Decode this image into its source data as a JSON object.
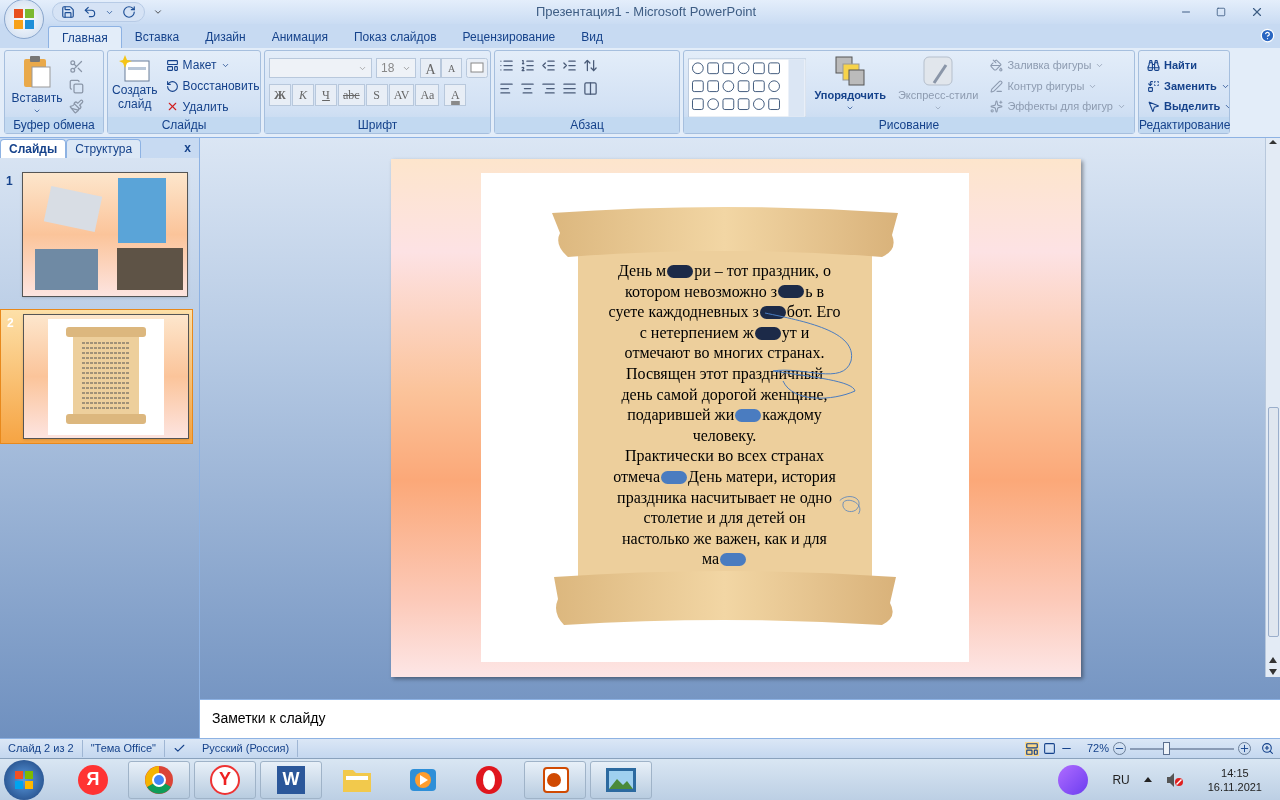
{
  "window": {
    "title": "Презентация1 - Microsoft PowerPoint"
  },
  "ribbon": {
    "tabs": [
      {
        "label": "Главная",
        "selected": true
      },
      {
        "label": "Вставка",
        "selected": false
      },
      {
        "label": "Дизайн",
        "selected": false
      },
      {
        "label": "Анимация",
        "selected": false
      },
      {
        "label": "Показ слайдов",
        "selected": false
      },
      {
        "label": "Рецензирование",
        "selected": false
      },
      {
        "label": "Вид",
        "selected": false
      }
    ],
    "clipboard": {
      "label": "Буфер обмена",
      "paste": "Вставить"
    },
    "slides": {
      "label": "Слайды",
      "new_slide": "Создать слайд",
      "layout": "Макет",
      "reset": "Восстановить",
      "delete": "Удалить"
    },
    "font": {
      "label": "Шрифт",
      "size": "18",
      "size_buttons": [
        "A",
        "A"
      ],
      "buttons": [
        "Ж",
        "К",
        "Ч",
        "abc",
        "S",
        "AV",
        "Aa",
        "A"
      ]
    },
    "paragraph": {
      "label": "Абзац"
    },
    "drawing": {
      "label": "Рисование",
      "arrange": "Упорядочить",
      "quick_styles": {
        "label": "Экспресс-стили",
        "disabled": true
      },
      "commands": [
        {
          "label": "Заливка фигуры",
          "disabled": true
        },
        {
          "label": "Контур фигуры",
          "disabled": true
        },
        {
          "label": "Эффекты для фигур",
          "disabled": true
        }
      ]
    },
    "editing": {
      "label": "Редактирование",
      "commands": [
        {
          "label": "Найти"
        },
        {
          "label": "Заменить"
        },
        {
          "label": "Выделить"
        }
      ]
    }
  },
  "slide_panel": {
    "tabs": [
      {
        "label": "Слайды",
        "selected": true
      },
      {
        "label": "Структура",
        "selected": false
      }
    ],
    "close": "x",
    "thumbnails": [
      {
        "number": "1",
        "selected": false
      },
      {
        "number": "2",
        "selected": true
      }
    ]
  },
  "slide": {
    "lines": [
      {
        "segments": [
          {
            "kind": "text",
            "text": "День м"
          },
          {
            "kind": "blot",
            "color": "#1c2a48"
          },
          {
            "kind": "text",
            "text": "ри – тот праздник, о"
          }
        ]
      },
      {
        "segments": [
          {
            "kind": "text",
            "text": "котором невозможно з"
          },
          {
            "kind": "blot",
            "color": "#1c2a48"
          },
          {
            "kind": "text",
            "text": "ь в"
          }
        ]
      },
      {
        "segments": [
          {
            "kind": "text",
            "text": "суете каждодневных з"
          },
          {
            "kind": "blot",
            "color": "#1c2a48"
          },
          {
            "kind": "text",
            "text": "бот. Его"
          }
        ]
      },
      {
        "segments": [
          {
            "kind": "text",
            "text": "с нетерпением ж"
          },
          {
            "kind": "blot",
            "color": "#1c2a48"
          },
          {
            "kind": "text",
            "text": "ут и"
          }
        ]
      },
      {
        "segments": [
          {
            "kind": "text",
            "text": "отмечают во многих странах."
          }
        ]
      },
      {
        "segments": [
          {
            "kind": "text",
            "text": "Посвящен этот праздничный"
          }
        ]
      },
      {
        "segments": [
          {
            "kind": "text",
            "text": "день самой дорогой женщине,"
          }
        ]
      },
      {
        "segments": [
          {
            "kind": "text",
            "text": "подарившей жи"
          },
          {
            "kind": "blot",
            "color": "#4a7cc0"
          },
          {
            "kind": "text",
            "text": "каждому"
          }
        ]
      },
      {
        "segments": [
          {
            "kind": "text",
            "text": "человеку."
          }
        ]
      },
      {
        "segments": [
          {
            "kind": "text",
            "text": "Практически во всех странах"
          }
        ]
      },
      {
        "segments": [
          {
            "kind": "text",
            "text": "отмеча"
          },
          {
            "kind": "blot",
            "color": "#4a7cc0"
          },
          {
            "kind": "text",
            "text": "День матери, история"
          }
        ]
      },
      {
        "segments": [
          {
            "kind": "text",
            "text": "праздника насчитывает не одно"
          }
        ]
      },
      {
        "segments": [
          {
            "kind": "text",
            "text": "столетие и для детей он"
          }
        ]
      },
      {
        "segments": [
          {
            "kind": "text",
            "text": "настолько же важен, как и для"
          }
        ]
      },
      {
        "segments": [
          {
            "kind": "text",
            "text": "ма"
          },
          {
            "kind": "blot",
            "color": "#4a7cc0"
          }
        ]
      }
    ]
  },
  "notes": {
    "placeholder": "Заметки к слайду"
  },
  "status_bar": {
    "slide": "Слайд 2 из 2",
    "theme": "\"Тема Office\"",
    "language": "Русский (Россия)",
    "zoom": "72%",
    "zoom_slider": {
      "level": 0.35
    }
  },
  "taskbar": {
    "apps": [
      {
        "kind": "yandex",
        "glyph": "Я",
        "running": false
      },
      {
        "kind": "chrome",
        "running": true
      },
      {
        "kind": "yandex-browser",
        "glyph": "Y",
        "running": true
      },
      {
        "kind": "word",
        "glyph": "W",
        "running": true
      },
      {
        "kind": "folder",
        "running": false
      },
      {
        "kind": "media",
        "running": false
      },
      {
        "kind": "opera",
        "running": false
      },
      {
        "kind": "powerpoint",
        "running": true
      },
      {
        "kind": "picture",
        "running": true
      }
    ],
    "language": "RU",
    "time": "14:15",
    "date": "16.11.2021"
  }
}
